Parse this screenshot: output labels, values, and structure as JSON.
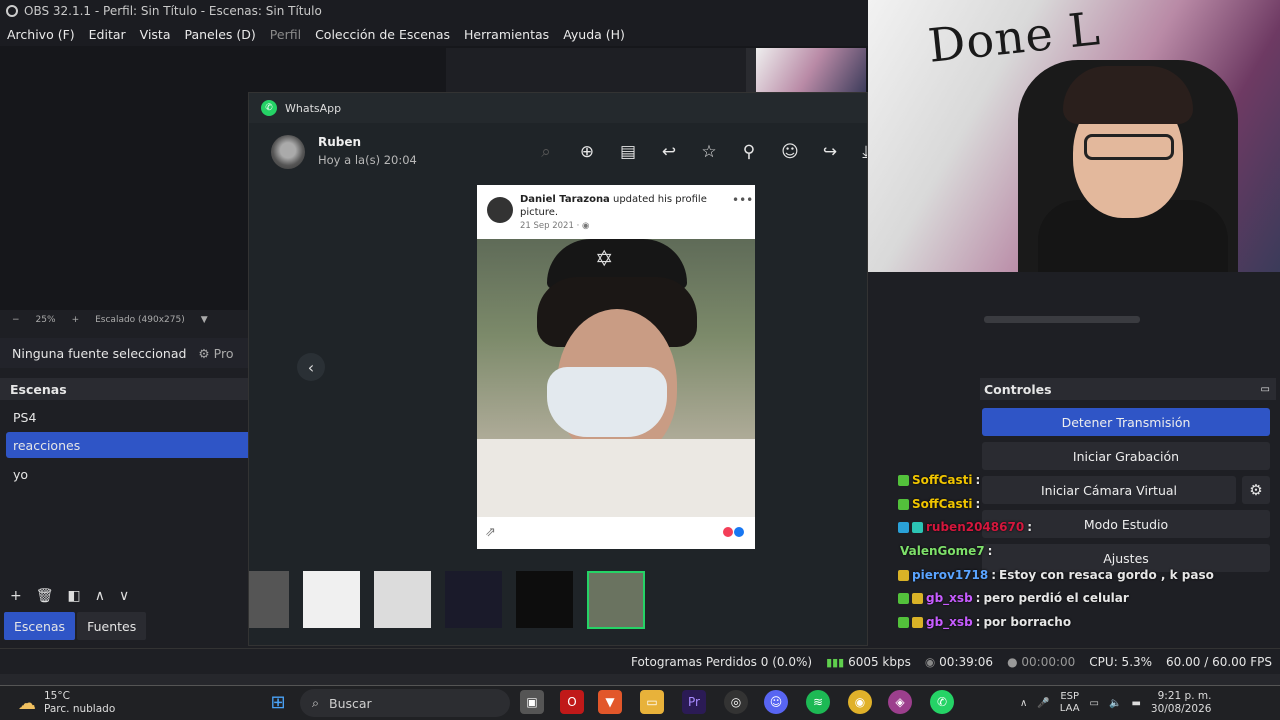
{
  "obs": {
    "title": "OBS 32.1.1 - Perfil: Sin Título - Escenas: Sin Título",
    "menu": [
      {
        "label": "Archivo (F)",
        "enabled": true
      },
      {
        "label": "Editar",
        "enabled": true
      },
      {
        "label": "Vista",
        "enabled": true
      },
      {
        "label": "Paneles (D)",
        "enabled": true
      },
      {
        "label": "Perfil",
        "enabled": false
      },
      {
        "label": "Colección de Escenas",
        "enabled": true
      },
      {
        "label": "Herramientas",
        "enabled": true
      },
      {
        "label": "Ayuda (H)",
        "enabled": true
      }
    ],
    "preview_bar": {
      "minus": "−",
      "zoom": "25%",
      "plus": "+",
      "scale": "Escalado (490x275)",
      "dropdown": "▼"
    },
    "source_bar": {
      "none_selected": "Ninguna fuente seleccionad",
      "properties": "Pro"
    },
    "scenes": {
      "title": "Escenas",
      "items": [
        "PS4",
        "reacciones",
        "yo"
      ],
      "selected_index": 1
    },
    "dock_tabs": [
      {
        "label": "Escenas",
        "active": true
      },
      {
        "label": "Fuentes",
        "active": false
      }
    ],
    "controls": {
      "title": "Controles",
      "stop_stream": "Detener Transmisión",
      "start_recording": "Iniciar Grabación",
      "start_virtual_cam": "Iniciar Cámara Virtual",
      "studio_mode": "Modo Estudio",
      "settings": "Ajustes"
    },
    "status": {
      "dropped_frames": "Fotogramas Perdidos 0 (0.0%)",
      "bitrate": "6005 kbps",
      "stream_time": "00:39:06",
      "record_time": "00:00:00",
      "cpu": "CPU: 5.3%",
      "fps": "60.00 / 60.00 FPS"
    }
  },
  "whatsapp": {
    "app_name": "WhatsApp",
    "contact_name": "Ruben",
    "timestamp": "Hoy a la(s) 20:04",
    "post": {
      "author": "Daniel Tarazona",
      "action": " updated his profile picture.",
      "date": "21 Sep 2021 · "
    }
  },
  "chat": [
    {
      "user": "SoffCasti",
      "text": "",
      "user_color": "#f0c400",
      "badges": [
        "green"
      ]
    },
    {
      "user": "SoffCasti",
      "text": "",
      "user_color": "#f0c400",
      "badges": [
        "green"
      ]
    },
    {
      "user": "ruben2048670",
      "text": "",
      "user_color": "#d4173d",
      "badges": [
        "blue",
        "teal"
      ]
    },
    {
      "user": "ValenGome7",
      "text": "",
      "user_color": "#7ee06a",
      "badges": []
    },
    {
      "user": "pierov1718",
      "text": "Estoy con resaca gordo , k paso",
      "user_color": "#5aa4ff",
      "badges": [
        "yellow"
      ]
    },
    {
      "user": "gb_xsb",
      "text": "pero perdió el celular",
      "user_color": "#c75cff",
      "badges": [
        "green",
        "yellow"
      ]
    },
    {
      "user": "gb_xsb",
      "text": "por borracho",
      "user_color": "#c75cff",
      "badges": [
        "green",
        "yellow"
      ]
    }
  ],
  "taskbar": {
    "temperature": "15°C",
    "weather": "Parc. nublado",
    "search": "Buscar",
    "lang_top": "ESP",
    "lang_bottom": "LAA",
    "time": "9:21 p. m.",
    "date": "30/08/2026"
  },
  "webcam": {
    "graffiti": "Done L"
  }
}
